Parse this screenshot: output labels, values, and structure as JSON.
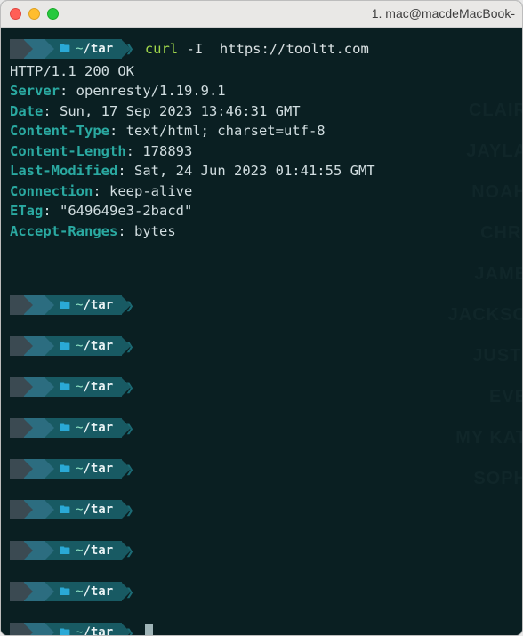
{
  "window": {
    "title": "1. mac@macdeMacBook-"
  },
  "prompt": {
    "apple_glyph": "",
    "chev": "〉",
    "folder_glyph": "🖿",
    "tilde": "~",
    "dir": "/tar",
    "end_chev": "❯"
  },
  "command": {
    "bin": "curl",
    "flag": "-I",
    "url": "https://tooltt.com"
  },
  "response": {
    "status": "HTTP/1.1 200 OK",
    "headers": [
      {
        "k": "Server",
        "v": "openresty/1.19.9.1"
      },
      {
        "k": "Date",
        "v": "Sun, 17 Sep 2023 13:46:31 GMT"
      },
      {
        "k": "Content-Type",
        "v": "text/html; charset=utf-8"
      },
      {
        "k": "Content-Length",
        "v": "178893"
      },
      {
        "k": "Last-Modified",
        "v": "Sat, 24 Jun 2023 01:41:55 GMT"
      },
      {
        "k": "Connection",
        "v": "keep-alive"
      },
      {
        "k": "ETag",
        "v": "\"649649e3-2bacd\""
      },
      {
        "k": "Accept-Ranges",
        "v": "bytes"
      }
    ]
  },
  "empty_prompt_count": 9
}
